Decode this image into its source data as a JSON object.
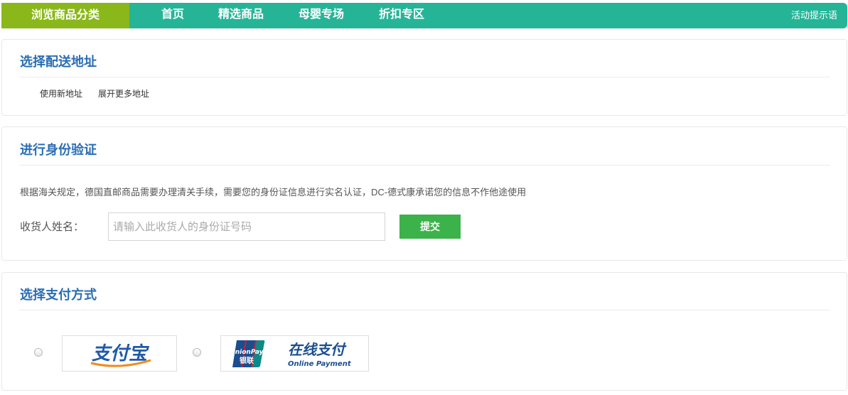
{
  "nav": {
    "category": "浏览商品分类",
    "links": [
      "首页",
      "精选商品",
      "母婴专场",
      "折扣专区"
    ],
    "tip": "活动提示语"
  },
  "address": {
    "title": "选择配送地址",
    "new_address": "使用新地址",
    "more_addresses": "展开更多地址"
  },
  "identity": {
    "title": "进行身份验证",
    "notice": "根据海关规定，德国直邮商品需要办理清关手续，需要您的身份证信息进行实名认证，DC-德式康承诺您的信息不作他途使用",
    "name_label": "收货人姓名：",
    "id_placeholder": "请输入此收货人的身份证号码",
    "submit": "提交"
  },
  "payment": {
    "title": "选择支付方式",
    "alipay_text": "支付宝",
    "unionpay_brand": "UnionPay",
    "unionpay_cn": "银联",
    "unionpay_title": "在线支付",
    "unionpay_sub": "Online Payment",
    "colors": {
      "alipay_blue": "#1f5aa8",
      "alipay_orange": "#f08a1c",
      "union_red": "#d81e2c",
      "union_blue": "#1a4e8f",
      "union_teal": "#0a8a8a"
    }
  }
}
